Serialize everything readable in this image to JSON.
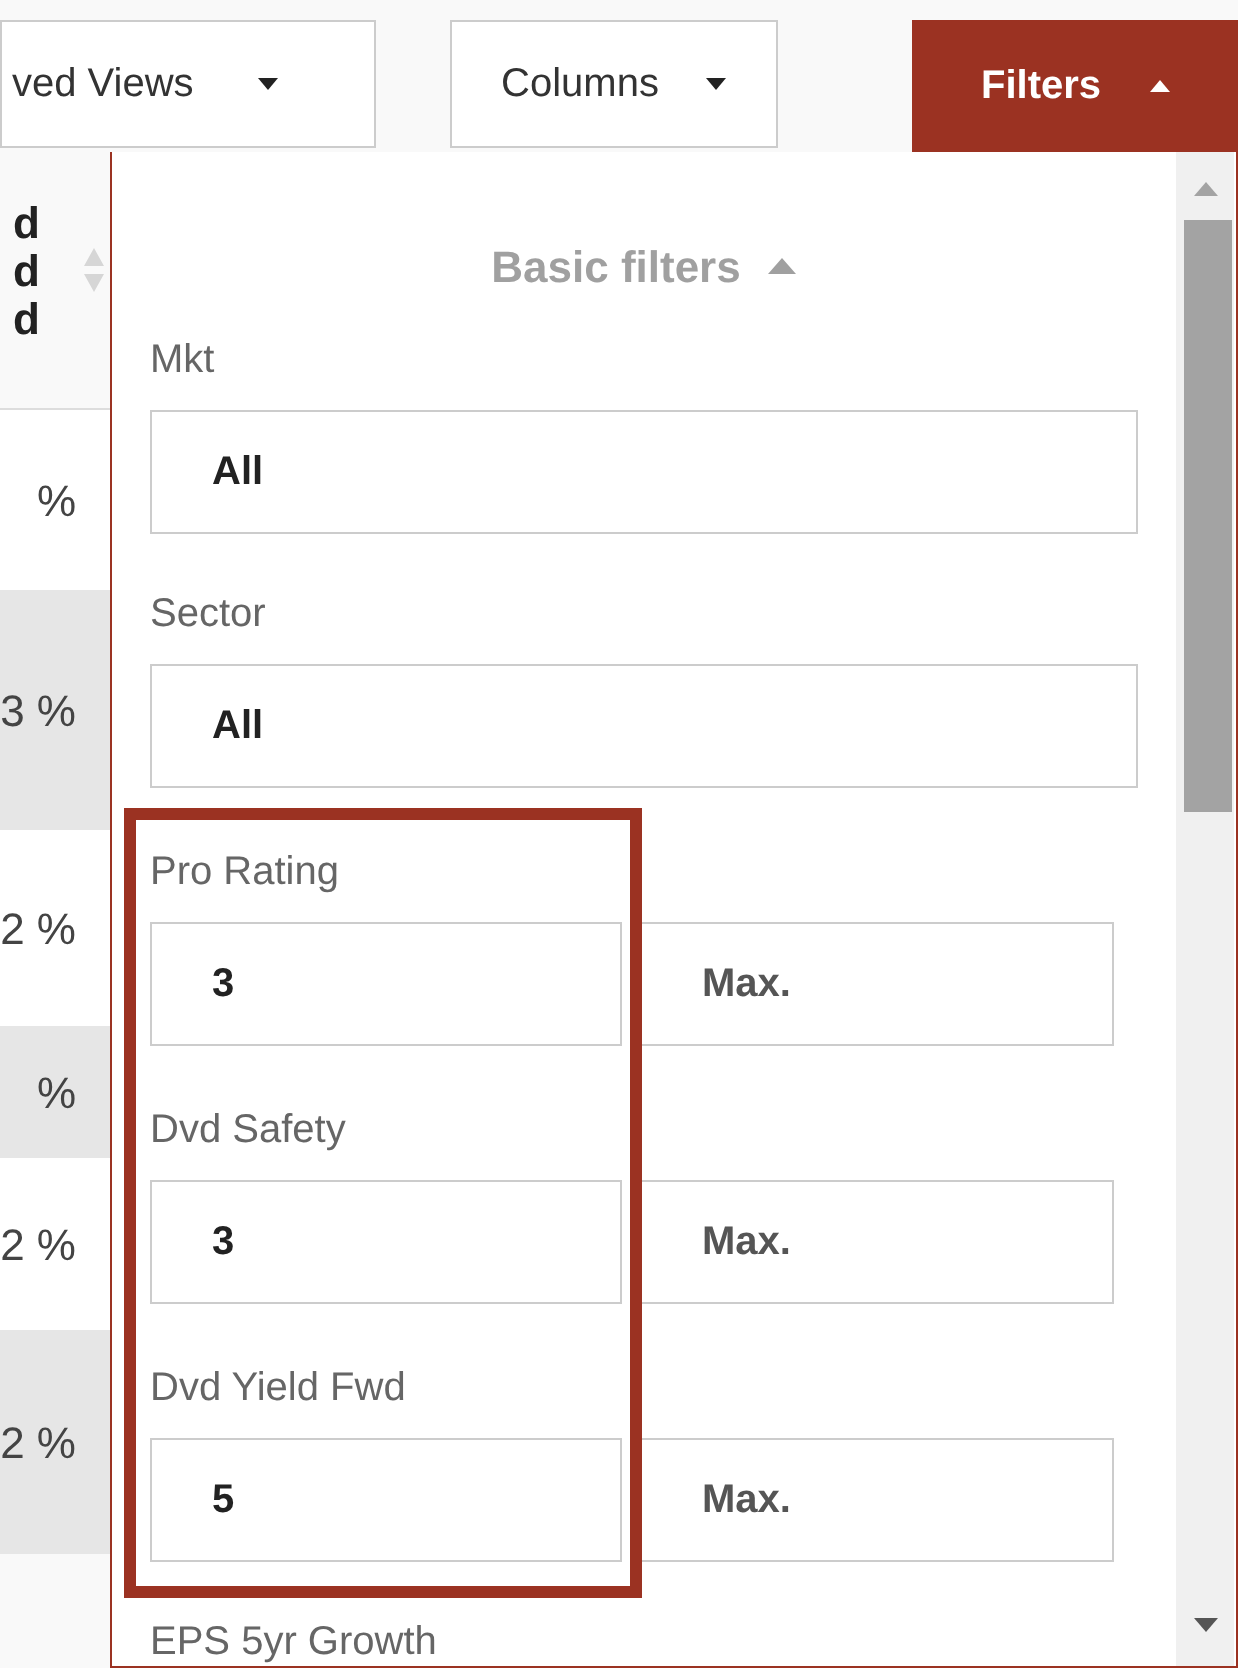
{
  "toolbar": {
    "buttons": [
      {
        "label": "ved Views",
        "selected": false
      },
      {
        "label": "Columns",
        "selected": false
      },
      {
        "label": "Filters",
        "selected": true
      }
    ]
  },
  "table": {
    "header": [
      "d",
      "d",
      "d"
    ],
    "rows": [
      "%",
      "3 %",
      "2 %",
      "%",
      "2 %",
      "2 %"
    ]
  },
  "filters": {
    "title": "Basic filters",
    "expanded": true,
    "selects": [
      {
        "label": "Mkt",
        "value": "All"
      },
      {
        "label": "Sector",
        "value": "All"
      }
    ],
    "ranges": [
      {
        "label": "Pro Rating",
        "min": "3",
        "max_placeholder": "Max."
      },
      {
        "label": "Dvd Safety",
        "min": "3",
        "max_placeholder": "Max."
      },
      {
        "label": "Dvd Yield Fwd",
        "min": "5",
        "max_placeholder": "Max."
      }
    ],
    "highlight_box": true,
    "next_label": "EPS 5yr Growth"
  }
}
